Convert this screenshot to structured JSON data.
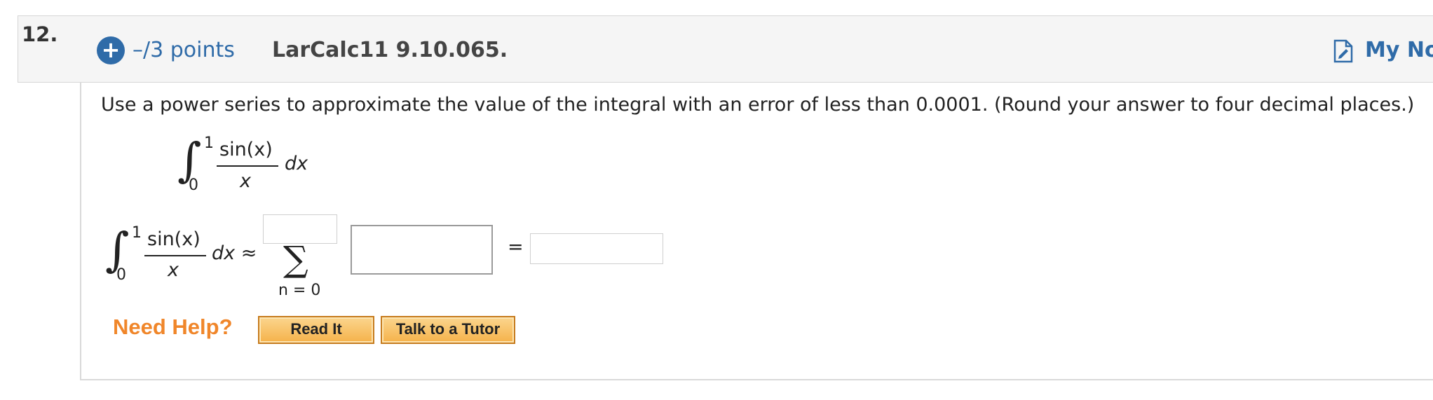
{
  "question": {
    "number": "12.",
    "points": "–/3 points",
    "problem_id": "LarCalc11 9.10.065.",
    "notes_label": "My Notes",
    "prompt": "Use a power series to approximate the value of the integral with an error of less than 0.0001. (Round your answer to four decimal places.)"
  },
  "integral": {
    "upper": "1",
    "lower": "0",
    "numerator": "sin(x)",
    "denominator": "x",
    "dx": "dx",
    "dx_approx": "dx ≈"
  },
  "sum": {
    "symbol": "∑",
    "index": "n = 0",
    "upper_value": "",
    "term_value": "",
    "result_value": "",
    "equals": "="
  },
  "help": {
    "label": "Need Help?",
    "read_it": "Read It",
    "tutor": "Talk to a Tutor"
  },
  "colors": {
    "accent": "#2f6ba8",
    "help_orange": "#f0862a",
    "button_fill": "#f5b24a"
  },
  "icons": {
    "add": "plus-circle-icon",
    "notes": "notes-icon"
  }
}
